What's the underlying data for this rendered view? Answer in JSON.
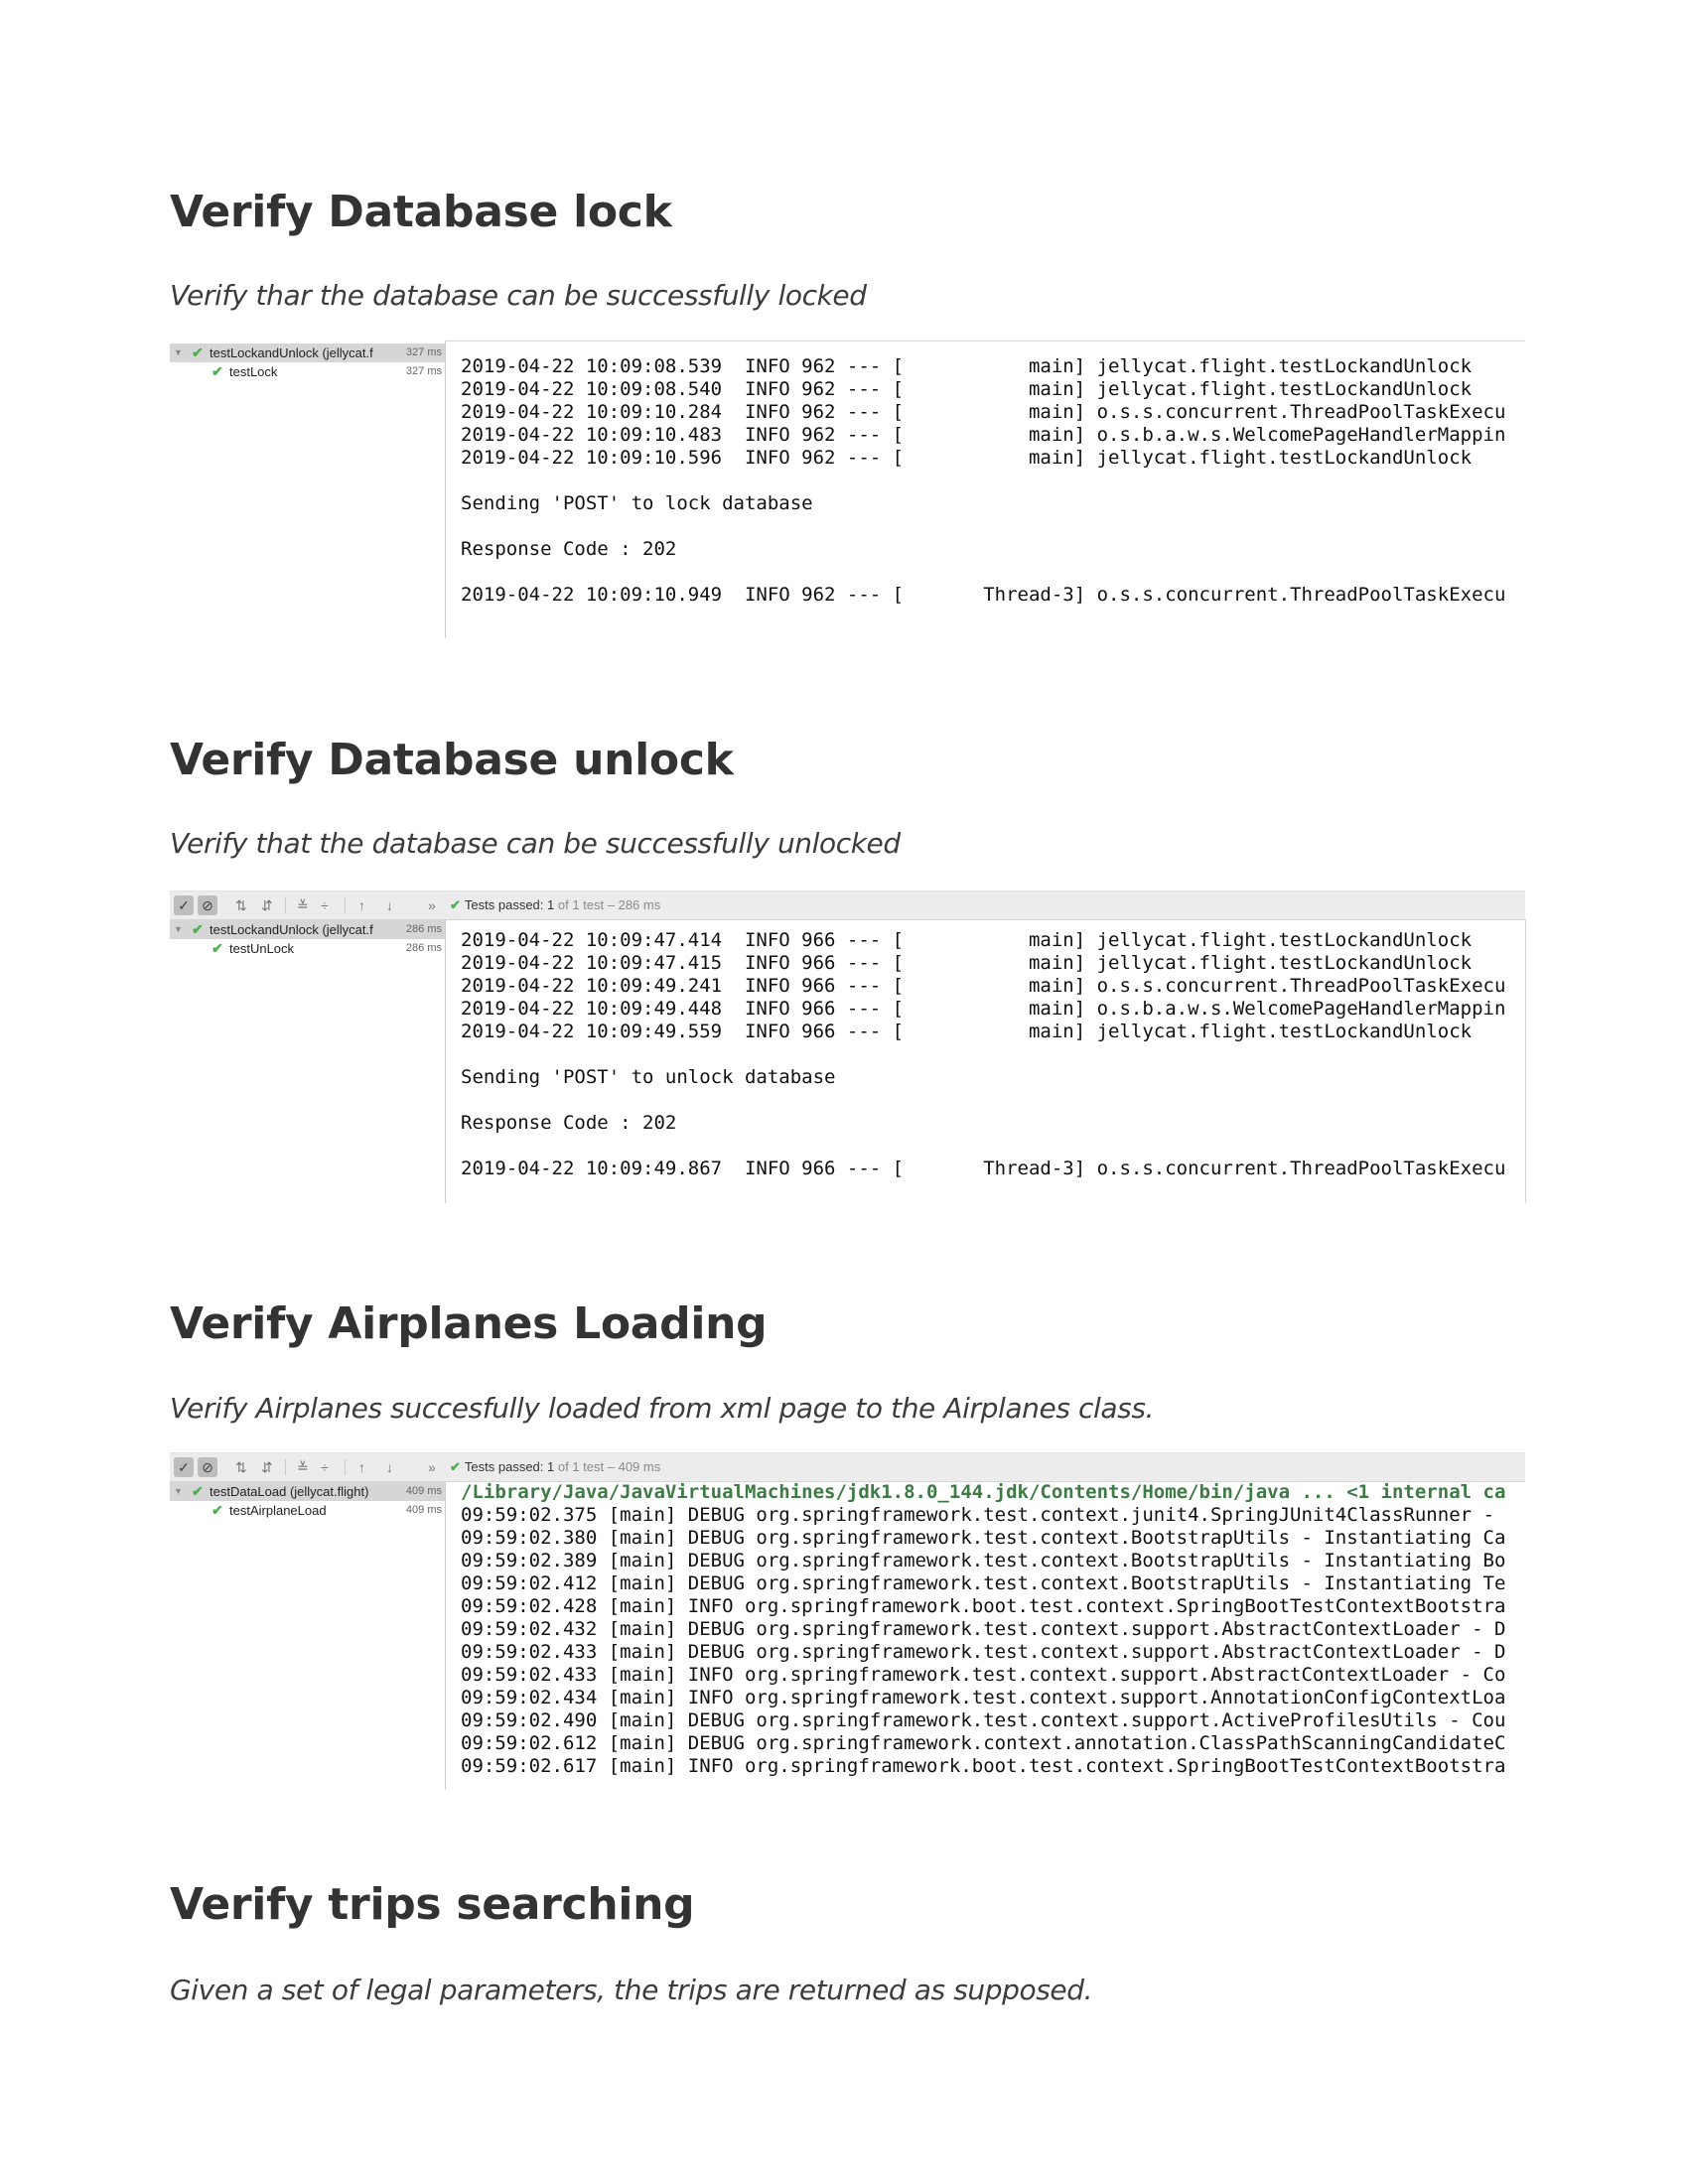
{
  "sections": [
    {
      "heading": "Verify Database lock",
      "description": "Verify thar the database can be successfully locked",
      "panel": {
        "toolbar": null,
        "tree": [
          {
            "name": "testLockandUnlock (jellycat.f",
            "duration": "327 ms",
            "level": 0
          },
          {
            "name": "testLock",
            "duration": "327 ms",
            "level": 1
          }
        ],
        "console": [
          "2019-04-22 10:09:08.539  INFO 962 --- [           main] jellycat.flight.testLockandUnlock",
          "2019-04-22 10:09:08.540  INFO 962 --- [           main] jellycat.flight.testLockandUnlock",
          "2019-04-22 10:09:10.284  INFO 962 --- [           main] o.s.s.concurrent.ThreadPoolTaskExecu",
          "2019-04-22 10:09:10.483  INFO 962 --- [           main] o.s.b.a.w.s.WelcomePageHandlerMappin",
          "2019-04-22 10:09:10.596  INFO 962 --- [           main] jellycat.flight.testLockandUnlock",
          "",
          "Sending 'POST' to lock database",
          "",
          "Response Code : 202",
          "",
          "2019-04-22 10:09:10.949  INFO 962 --- [       Thread-3] o.s.s.concurrent.ThreadPoolTaskExecu"
        ]
      }
    },
    {
      "heading": "Verify Database unlock",
      "description": "Verify that the database can be successfully unlocked",
      "panel": {
        "toolbar": {
          "status_label": "Tests passed:",
          "status_count": "1",
          "status_rest": "of 1 test – 286 ms"
        },
        "tree": [
          {
            "name": "testLockandUnlock (jellycat.f",
            "duration": "286 ms",
            "level": 0
          },
          {
            "name": "testUnLock",
            "duration": "286 ms",
            "level": 1
          }
        ],
        "console": [
          "2019-04-22 10:09:47.414  INFO 966 --- [           main] jellycat.flight.testLockandUnlock",
          "2019-04-22 10:09:47.415  INFO 966 --- [           main] jellycat.flight.testLockandUnlock",
          "2019-04-22 10:09:49.241  INFO 966 --- [           main] o.s.s.concurrent.ThreadPoolTaskExecu",
          "2019-04-22 10:09:49.448  INFO 966 --- [           main] o.s.b.a.w.s.WelcomePageHandlerMappin",
          "2019-04-22 10:09:49.559  INFO 966 --- [           main] jellycat.flight.testLockandUnlock",
          "",
          "Sending 'POST' to unlock database",
          "",
          "Response Code : 202",
          "",
          "2019-04-22 10:09:49.867  INFO 966 --- [       Thread-3] o.s.s.concurrent.ThreadPoolTaskExecu"
        ]
      }
    },
    {
      "heading": "Verify Airplanes Loading",
      "description": "Verify Airplanes succesfully loaded from xml page to the Airplanes class.",
      "panel": {
        "toolbar": {
          "status_label": "Tests passed:",
          "status_count": "1",
          "status_rest": "of 1 test – 409 ms"
        },
        "tree": [
          {
            "name": "testDataLoad (jellycat.flight)",
            "duration": "409 ms",
            "level": 0
          },
          {
            "name": "testAirplaneLoad",
            "duration": "409 ms",
            "level": 1
          }
        ],
        "console": [
          "/Library/Java/JavaVirtualMachines/jdk1.8.0_144.jdk/Contents/Home/bin/java ... <1 internal ca",
          "09:59:02.375 [main] DEBUG org.springframework.test.context.junit4.SpringJUnit4ClassRunner -",
          "09:59:02.380 [main] DEBUG org.springframework.test.context.BootstrapUtils - Instantiating Ca",
          "09:59:02.389 [main] DEBUG org.springframework.test.context.BootstrapUtils - Instantiating Bo",
          "09:59:02.412 [main] DEBUG org.springframework.test.context.BootstrapUtils - Instantiating Te",
          "09:59:02.428 [main] INFO org.springframework.boot.test.context.SpringBootTestContextBootstra",
          "09:59:02.432 [main] DEBUG org.springframework.test.context.support.AbstractContextLoader - D",
          "09:59:02.433 [main] DEBUG org.springframework.test.context.support.AbstractContextLoader - D",
          "09:59:02.433 [main] INFO org.springframework.test.context.support.AbstractContextLoader - Co",
          "09:59:02.434 [main] INFO org.springframework.test.context.support.AnnotationConfigContextLoa",
          "09:59:02.490 [main] DEBUG org.springframework.test.context.support.ActiveProfilesUtils - Cou",
          "09:59:02.612 [main] DEBUG org.springframework.context.annotation.ClassPathScanningCandidateC",
          "09:59:02.617 [main] INFO org.springframework.boot.test.context.SpringBootTestContextBootstra"
        ]
      }
    },
    {
      "heading": "Verify trips searching",
      "description": "Given a set of legal parameters, the trips are returned as supposed."
    }
  ],
  "toolbar_icons": [
    "check-toggle-icon",
    "stop-icon",
    "sort-alpha-icon",
    "sort-duration-icon",
    "expand-all-icon",
    "collapse-all-icon",
    "up-arrow-icon",
    "down-arrow-icon",
    "more-icon"
  ],
  "colors": {
    "pass_green": "#4caf50",
    "heading": "#333333",
    "path_green": "#3d7a44"
  }
}
